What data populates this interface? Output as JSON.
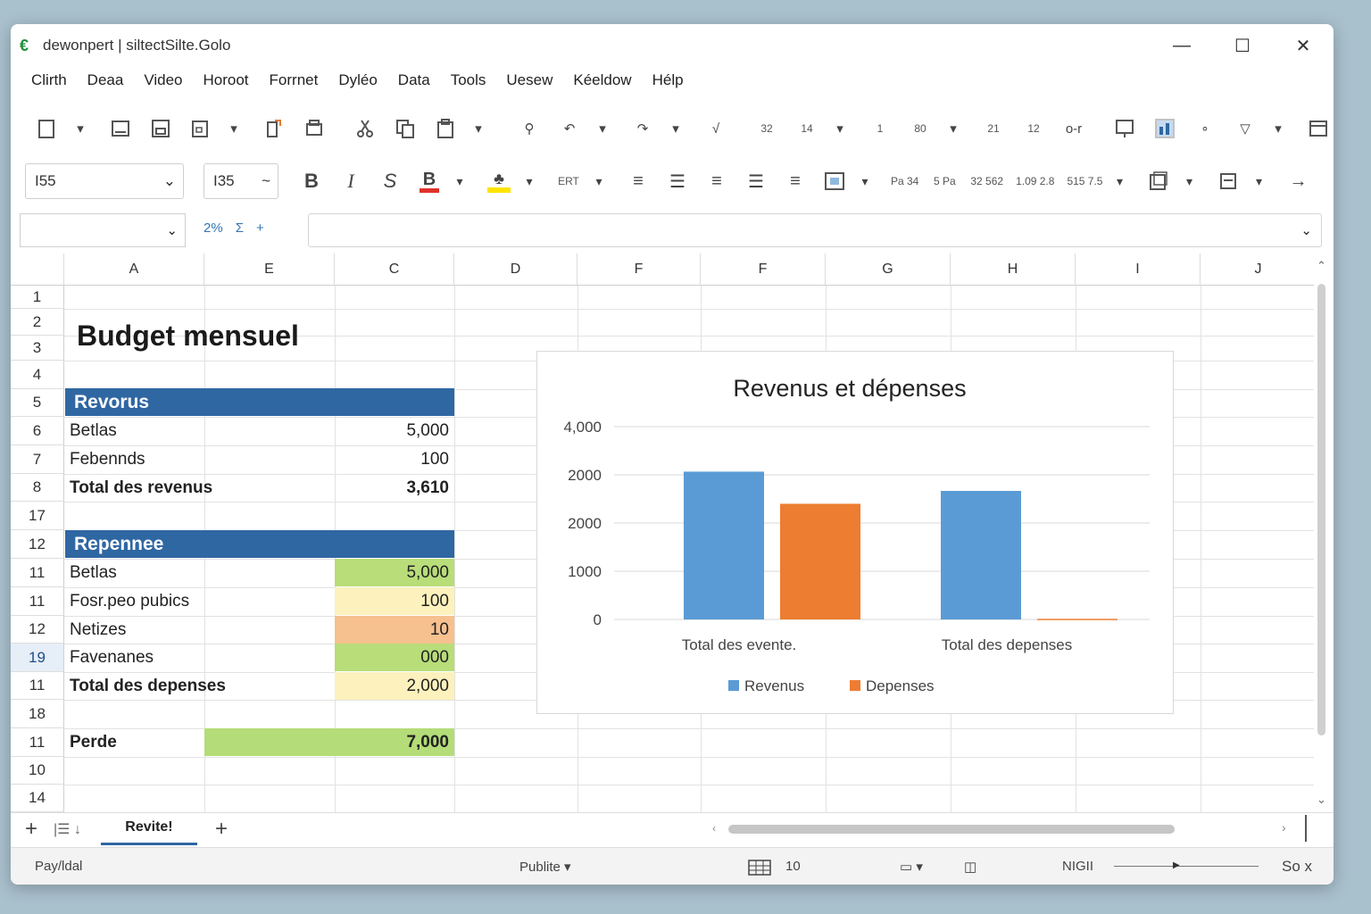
{
  "window": {
    "app_icon": "€",
    "title": "dewonpert | siltectSilte.Golo",
    "minimize": "—",
    "maximize": "☐",
    "close": "✕"
  },
  "menu": [
    "Clirth",
    "Deaa",
    "Video",
    "Horoot",
    "Forrnet",
    "Dyléo",
    "Data",
    "Tools",
    "Uesew",
    "Kéeldow",
    "Hélp"
  ],
  "format_bar": {
    "font_name": "I55",
    "font_size": "I35",
    "bold": "B",
    "italic": "I",
    "strike": "S",
    "small_1": "ERT",
    "num_fmt": [
      "Pa 34",
      "5 Pa",
      "32 562",
      "1.09 2.8",
      "515 7.5"
    ],
    "highlight_color": "#ffe400",
    "font_color": "#e0312a"
  },
  "ribbon_labels": {
    "n1": "32",
    "n2": "14",
    "n3": "1",
    "n4": "80",
    "n5": "21",
    "n6": "12",
    "ko": "o-r"
  },
  "formula_bar": {
    "name_box": "",
    "fx_a": "2%",
    "fx_b": "Σ",
    "fx_c": "+",
    "value": ""
  },
  "columns": [
    "A",
    "E",
    "C",
    "D",
    "F",
    "F",
    "G",
    "H",
    "I",
    "J"
  ],
  "rows": [
    "1",
    "2",
    "3",
    "4",
    "5",
    "6",
    "7",
    "8",
    "17",
    "12",
    "11",
    "11",
    "12",
    "19",
    "11",
    "18",
    "11",
    "10",
    "14"
  ],
  "sheet": {
    "title": "Budget mensuel",
    "revenus_header": "Revorus",
    "revenus": [
      {
        "label": "Betlas",
        "value": "5,000"
      },
      {
        "label": "Febennds",
        "value": "100"
      }
    ],
    "revenus_total": {
      "label": "Total des revenus",
      "value": "3,610"
    },
    "depenses_header": "Repennee",
    "depenses": [
      {
        "label": "Betlas",
        "value": "5,000",
        "color": "#b8dd79"
      },
      {
        "label": "Fosr.peo pubics",
        "value": "100",
        "color": "#fdf1bd"
      },
      {
        "label": "Netizes",
        "value": "10",
        "color": "#f6c08f"
      },
      {
        "label": "Favenanes",
        "value": "000",
        "color": "#b8dd79"
      }
    ],
    "depenses_total": {
      "label": "Total des depenses",
      "value": "2,000",
      "color": "#fdf1bd"
    },
    "perte": {
      "label": "Perde",
      "value": "7,000",
      "color": "#b4dc78"
    }
  },
  "chart_data": {
    "type": "bar",
    "title": "Revenus et dépenses",
    "categories": [
      "Total des evente.",
      "Total des depenses"
    ],
    "series": [
      {
        "name": "Revenus",
        "values": [
          2300,
          2000
        ],
        "color": "#5b9bd5"
      },
      {
        "name": "Depenses",
        "values": [
          1800,
          10
        ],
        "color": "#ed7d31"
      }
    ],
    "y_tick_labels": [
      "0",
      "1000",
      "2000",
      "2000",
      "4,000"
    ],
    "ylim": [
      0,
      3000
    ],
    "grid": true,
    "legend": "bottom"
  },
  "sheet_tabs": {
    "add": "+",
    "nav": "|☰ ↓",
    "active_tab": "Revite!",
    "add2": "+"
  },
  "status": {
    "left": "Pay/ldal",
    "mode": "Publite ▾",
    "count": "10",
    "zoom_label": "NIGII",
    "zoom_value": "So x"
  }
}
